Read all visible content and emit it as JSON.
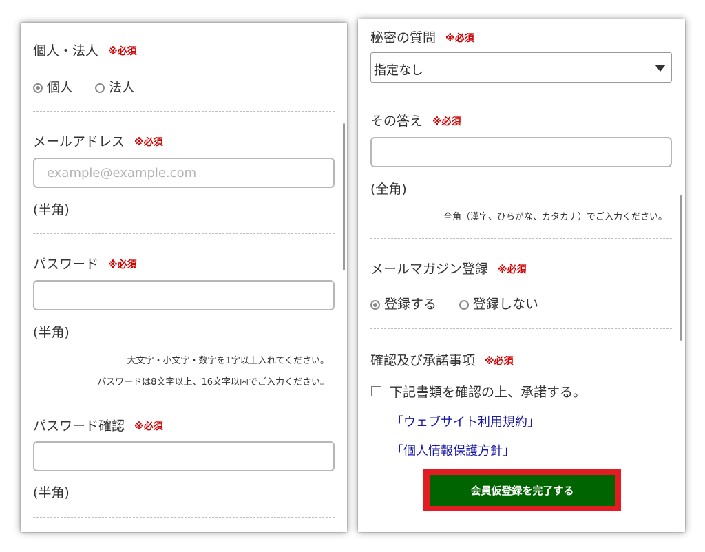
{
  "required_mark": "※必須",
  "left": {
    "entity_type": {
      "label": "個人・法人",
      "options": [
        "個人",
        "法人"
      ],
      "selected": "個人"
    },
    "email": {
      "label": "メールアドレス",
      "placeholder": "example@example.com",
      "hint": "(半角)"
    },
    "password": {
      "label": "パスワード",
      "hint": "(半角)",
      "notes": [
        "大文字・小文字・数字を1字以上入れてください。",
        "パスワードは8文字以上、16文字以内でご入力ください。"
      ]
    },
    "password_confirm": {
      "label": "パスワード確認",
      "hint": "(半角)"
    }
  },
  "right": {
    "secret_question": {
      "label": "秘密の質問",
      "selected": "指定なし"
    },
    "answer": {
      "label": "その答え",
      "hint": "(全角)",
      "note": "全角（漢字、ひらがな、カタカナ）でご入力ください。"
    },
    "newsletter": {
      "label": "メールマガジン登録",
      "options": [
        "登録する",
        "登録しない"
      ],
      "selected": "登録する"
    },
    "agreement": {
      "label": "確認及び承諾事項",
      "checkbox_label": "下記書類を確認の上、承諾する。",
      "links": [
        "「ウェブサイト利用規約」",
        "「個人情報保護方針」"
      ]
    },
    "submit_label": "会員仮登録を完了する"
  },
  "colors": {
    "required": "#d20000",
    "submit_bg": "#006400",
    "highlight": "#e31b23",
    "link": "#1a1aa6"
  }
}
